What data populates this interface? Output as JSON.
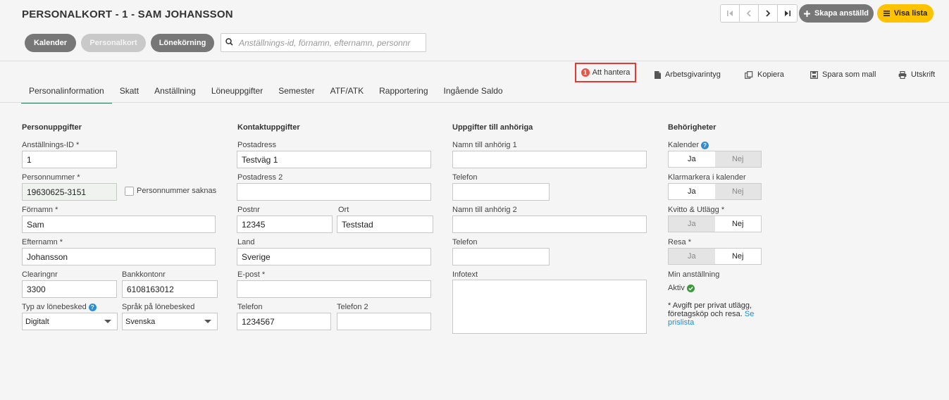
{
  "header": {
    "title": "PERSONALKORT - 1 - SAM JOHANSSON",
    "create_label": "Skapa anställd",
    "list_label": "Visa lista"
  },
  "nav": {
    "calendar": "Kalender",
    "personalkort": "Personalkort",
    "payroll": "Lönekörning",
    "search_placeholder": "Anställnings-id, förnamn, efternamn, personnr"
  },
  "actions": {
    "todo_count": "1",
    "todo_label": "Att hantera",
    "certificate": "Arbetsgivarintyg",
    "copy": "Kopiera",
    "save_template": "Spara som mall",
    "print": "Utskrift"
  },
  "tabs": [
    "Personalinformation",
    "Skatt",
    "Anställning",
    "Löneuppgifter",
    "Semester",
    "ATF/ATK",
    "Rapportering",
    "Ingående Saldo"
  ],
  "person": {
    "heading": "Personuppgifter",
    "id_label": "Anställnings-ID *",
    "id_value": "1",
    "pnr_label": "Personnummer *",
    "pnr_value": "19630625-3151",
    "pnr_missing": "Personnummer saknas",
    "first_label": "Förnamn *",
    "first_value": "Sam",
    "last_label": "Efternamn *",
    "last_value": "Johansson",
    "clearing_label": "Clearingnr",
    "clearing_value": "3300",
    "account_label": "Bankkontonr",
    "account_value": "6108163012",
    "payslip_type_label": "Typ av lönebesked",
    "payslip_type_value": "Digitalt",
    "payslip_lang_label": "Språk på lönebesked",
    "payslip_lang_value": "Svenska"
  },
  "contact": {
    "heading": "Kontaktuppgifter",
    "address_label": "Postadress",
    "address_value": "Testväg 1",
    "address2_label": "Postadress 2",
    "address2_value": "",
    "zip_label": "Postnr",
    "zip_value": "12345",
    "city_label": "Ort",
    "city_value": "Teststad",
    "country_label": "Land",
    "country_value": "Sverige",
    "email_label": "E-post *",
    "email_value": "",
    "phone_label": "Telefon",
    "phone_value": "1234567",
    "phone2_label": "Telefon 2",
    "phone2_value": ""
  },
  "relatives": {
    "heading": "Uppgifter till anhöriga",
    "name1_label": "Namn till anhörig 1",
    "phone1_label": "Telefon",
    "name2_label": "Namn till anhörig 2",
    "phone2_label": "Telefon",
    "info_label": "Infotext"
  },
  "permissions": {
    "heading": "Behörigheter",
    "calendar_label": "Kalender",
    "mark_label": "Klarmarkera i kalender",
    "receipt_label": "Kvitto & Utlägg *",
    "travel_label": "Resa *",
    "yes": "Ja",
    "no": "Nej",
    "employment_label": "Min anställning",
    "employment_status": "Aktiv",
    "note": "* Avgift per privat utlägg, företagsköp och resa.",
    "note_link": "Se prislista"
  },
  "colors": {
    "accent_yellow": "#fdc300",
    "tab_active": "#2e7d5b",
    "highlight_red": "#e53935",
    "link": "#1a8dd6"
  }
}
